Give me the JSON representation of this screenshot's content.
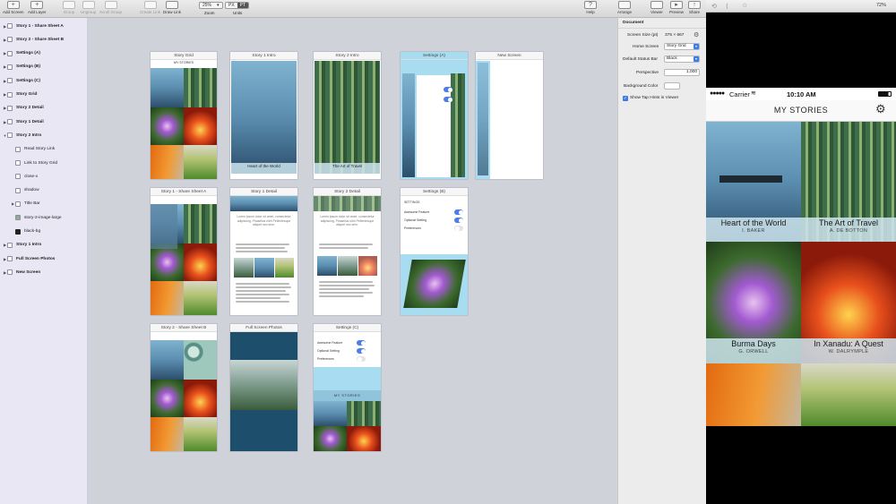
{
  "toolbar": {
    "add_screen": "Add Screen",
    "add_layer": "Add Layer",
    "group": "Group",
    "ungroup": "Ungroup",
    "scroll_group": "Scroll Group",
    "create_link": "Create Link",
    "draw_link": "Draw Link",
    "zoom_value": "25%",
    "zoom_label": "Zoom",
    "units_px": "PX",
    "units_pt": "PT",
    "units_label": "Units",
    "help": "Help",
    "arrange": "Arrange",
    "viewer": "Viewer",
    "preview": "Preview",
    "share": "Share"
  },
  "layers": [
    {
      "label": "Story 1 - Share Sheet A",
      "type": "screen"
    },
    {
      "label": "Story 2 - Share Sheet B",
      "type": "screen"
    },
    {
      "label": "Settings (A)",
      "type": "screen"
    },
    {
      "label": "Settings (B)",
      "type": "screen"
    },
    {
      "label": "Settings (C)",
      "type": "screen"
    },
    {
      "label": "Story Grid",
      "type": "screen"
    },
    {
      "label": "Story 2 Detail",
      "type": "screen"
    },
    {
      "label": "Story 1 Detail",
      "type": "screen"
    },
    {
      "label": "Story 2 Intro",
      "type": "screen-open"
    },
    {
      "label": "Read Story Link",
      "type": "child"
    },
    {
      "label": "Link to Story Grid",
      "type": "child"
    },
    {
      "label": "close-x",
      "type": "child"
    },
    {
      "label": "shadow",
      "type": "child"
    },
    {
      "label": "Title Bar",
      "type": "child-group"
    },
    {
      "label": "story-2-image-large",
      "type": "child-img"
    },
    {
      "label": "black-bg",
      "type": "child-dark"
    },
    {
      "label": "Story 1 Intro",
      "type": "screen"
    },
    {
      "label": "Full Screen Photos",
      "type": "screen"
    },
    {
      "label": "New Screen",
      "type": "screen"
    }
  ],
  "artboards": {
    "story_grid": "Story Grid",
    "story_1_intro": "Story 1 Intro",
    "story_2_intro": "Story 2 Intro",
    "settings_a": "Settings (A)",
    "new_screen": "New Screen",
    "story_1_share": "Story 1 - Share Sheet A",
    "story_1_detail": "Story 1 Detail",
    "story_2_detail": "Story 2 Detail",
    "settings_b": "Settings (B)",
    "story_2_share": "Story 2 - Share Sheet B",
    "full_screen_photos": "Full Screen Photos",
    "settings_c": "Settings (C)",
    "mini_nav": "MY STORIES",
    "mini_heart": "Heart of the World",
    "mini_travel": "The Art of Travel",
    "mini_settings_hdr": "SETTINGS",
    "mini_awesome": "Awesome Feature",
    "mini_optional": "Optional Setting",
    "mini_preferences": "Preferences",
    "mini_my_stories": "MY STORIES",
    "mini_detail_heading": "Lorem ipsum dolor sit amet, consectetur adipiscing. Phasellus nibh Pellentesque aliquet nec sem."
  },
  "properties": {
    "section": "Document",
    "screen_size_label": "Screen Size (pt)",
    "screen_size_value": "375 × 667",
    "home_screen_label": "Home Screen",
    "home_screen_value": "Story Grid",
    "status_bar_label": "Default Status Bar",
    "status_bar_value": "Black",
    "perspective_label": "Perspective",
    "perspective_value": "1,000",
    "background_label": "Background Color",
    "tap_hints_label": "Show Tap Hints in Viewer",
    "tap_hints_checked": true
  },
  "preview": {
    "zoom": "72%",
    "carrier": "Carrier",
    "time": "10:10 AM",
    "nav_title": "MY STORIES",
    "stories": [
      {
        "title": "Heart of the World",
        "author": "I. BAKER"
      },
      {
        "title": "The Art of Travel",
        "author": "A. DE BOTTON"
      },
      {
        "title": "Burma Days",
        "author": "G. ORWELL"
      },
      {
        "title": "In Xanadu: A Quest",
        "author": "W. DALRYMPLE"
      }
    ]
  },
  "colors": {
    "accent": "#3a7de8",
    "canvas_bg": "#cfd3d9",
    "layers_bg": "#e9e7f4",
    "band": "#cde4ee"
  }
}
